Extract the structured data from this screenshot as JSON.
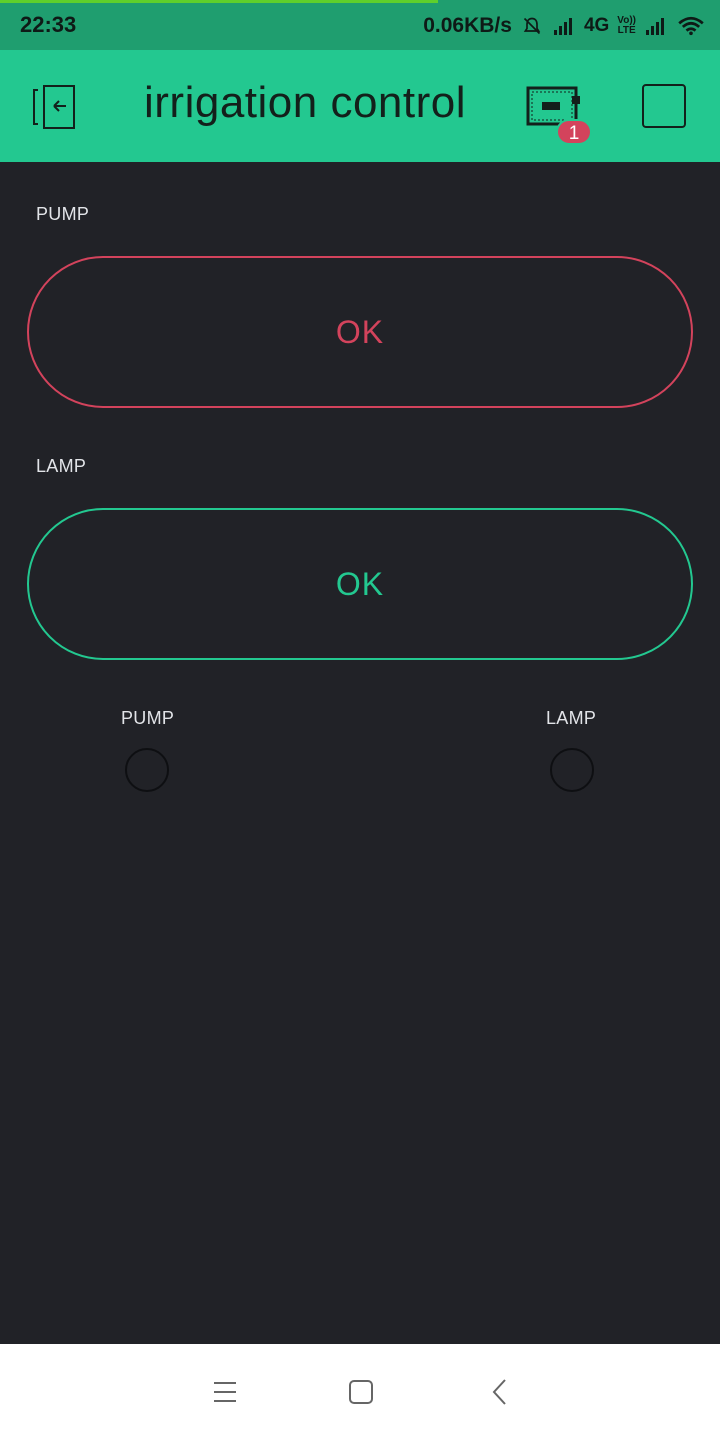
{
  "status_bar": {
    "time": "22:33",
    "net_speed": "0.06KB/s",
    "network_type": "4G",
    "volte_top": "Vo))",
    "volte_bottom": "LTE"
  },
  "app_bar": {
    "title": "irrigation control",
    "device_badge_count": "1"
  },
  "widgets": {
    "pump_button": {
      "label": "PUMP",
      "text": "OK",
      "color": "#d3435c"
    },
    "lamp_button": {
      "label": "LAMP",
      "text": "OK",
      "color": "#23c890"
    },
    "pump_led": {
      "label": "PUMP",
      "on": false
    },
    "lamp_led": {
      "label": "LAMP",
      "on": false
    }
  },
  "colors": {
    "background": "#212227",
    "app_bar": "#23c890",
    "status_bar": "#1f9e6f",
    "accent_red": "#d3435c",
    "accent_green": "#23c890"
  },
  "icons": [
    "back-icon",
    "device-icon",
    "stop-icon",
    "mute-icon",
    "signal-icon",
    "wifi-icon",
    "menu-icon",
    "home-icon",
    "nav-back-icon"
  ]
}
